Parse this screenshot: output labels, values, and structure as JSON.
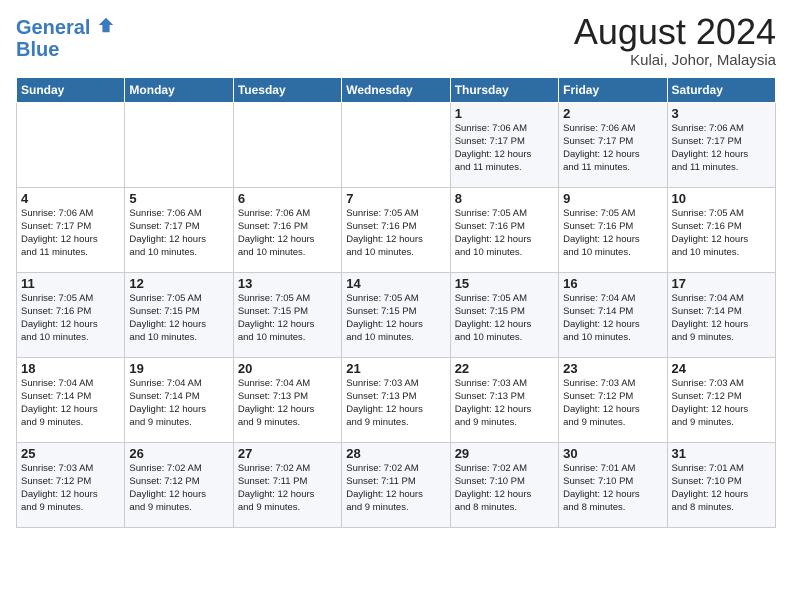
{
  "logo": {
    "line1": "General",
    "line2": "Blue"
  },
  "title": "August 2024",
  "subtitle": "Kulai, Johor, Malaysia",
  "weekdays": [
    "Sunday",
    "Monday",
    "Tuesday",
    "Wednesday",
    "Thursday",
    "Friday",
    "Saturday"
  ],
  "weeks": [
    [
      {
        "day": "",
        "info": ""
      },
      {
        "day": "",
        "info": ""
      },
      {
        "day": "",
        "info": ""
      },
      {
        "day": "",
        "info": ""
      },
      {
        "day": "1",
        "info": "Sunrise: 7:06 AM\nSunset: 7:17 PM\nDaylight: 12 hours\nand 11 minutes."
      },
      {
        "day": "2",
        "info": "Sunrise: 7:06 AM\nSunset: 7:17 PM\nDaylight: 12 hours\nand 11 minutes."
      },
      {
        "day": "3",
        "info": "Sunrise: 7:06 AM\nSunset: 7:17 PM\nDaylight: 12 hours\nand 11 minutes."
      }
    ],
    [
      {
        "day": "4",
        "info": "Sunrise: 7:06 AM\nSunset: 7:17 PM\nDaylight: 12 hours\nand 11 minutes."
      },
      {
        "day": "5",
        "info": "Sunrise: 7:06 AM\nSunset: 7:17 PM\nDaylight: 12 hours\nand 10 minutes."
      },
      {
        "day": "6",
        "info": "Sunrise: 7:06 AM\nSunset: 7:16 PM\nDaylight: 12 hours\nand 10 minutes."
      },
      {
        "day": "7",
        "info": "Sunrise: 7:05 AM\nSunset: 7:16 PM\nDaylight: 12 hours\nand 10 minutes."
      },
      {
        "day": "8",
        "info": "Sunrise: 7:05 AM\nSunset: 7:16 PM\nDaylight: 12 hours\nand 10 minutes."
      },
      {
        "day": "9",
        "info": "Sunrise: 7:05 AM\nSunset: 7:16 PM\nDaylight: 12 hours\nand 10 minutes."
      },
      {
        "day": "10",
        "info": "Sunrise: 7:05 AM\nSunset: 7:16 PM\nDaylight: 12 hours\nand 10 minutes."
      }
    ],
    [
      {
        "day": "11",
        "info": "Sunrise: 7:05 AM\nSunset: 7:16 PM\nDaylight: 12 hours\nand 10 minutes."
      },
      {
        "day": "12",
        "info": "Sunrise: 7:05 AM\nSunset: 7:15 PM\nDaylight: 12 hours\nand 10 minutes."
      },
      {
        "day": "13",
        "info": "Sunrise: 7:05 AM\nSunset: 7:15 PM\nDaylight: 12 hours\nand 10 minutes."
      },
      {
        "day": "14",
        "info": "Sunrise: 7:05 AM\nSunset: 7:15 PM\nDaylight: 12 hours\nand 10 minutes."
      },
      {
        "day": "15",
        "info": "Sunrise: 7:05 AM\nSunset: 7:15 PM\nDaylight: 12 hours\nand 10 minutes."
      },
      {
        "day": "16",
        "info": "Sunrise: 7:04 AM\nSunset: 7:14 PM\nDaylight: 12 hours\nand 10 minutes."
      },
      {
        "day": "17",
        "info": "Sunrise: 7:04 AM\nSunset: 7:14 PM\nDaylight: 12 hours\nand 9 minutes."
      }
    ],
    [
      {
        "day": "18",
        "info": "Sunrise: 7:04 AM\nSunset: 7:14 PM\nDaylight: 12 hours\nand 9 minutes."
      },
      {
        "day": "19",
        "info": "Sunrise: 7:04 AM\nSunset: 7:14 PM\nDaylight: 12 hours\nand 9 minutes."
      },
      {
        "day": "20",
        "info": "Sunrise: 7:04 AM\nSunset: 7:13 PM\nDaylight: 12 hours\nand 9 minutes."
      },
      {
        "day": "21",
        "info": "Sunrise: 7:03 AM\nSunset: 7:13 PM\nDaylight: 12 hours\nand 9 minutes."
      },
      {
        "day": "22",
        "info": "Sunrise: 7:03 AM\nSunset: 7:13 PM\nDaylight: 12 hours\nand 9 minutes."
      },
      {
        "day": "23",
        "info": "Sunrise: 7:03 AM\nSunset: 7:12 PM\nDaylight: 12 hours\nand 9 minutes."
      },
      {
        "day": "24",
        "info": "Sunrise: 7:03 AM\nSunset: 7:12 PM\nDaylight: 12 hours\nand 9 minutes."
      }
    ],
    [
      {
        "day": "25",
        "info": "Sunrise: 7:03 AM\nSunset: 7:12 PM\nDaylight: 12 hours\nand 9 minutes."
      },
      {
        "day": "26",
        "info": "Sunrise: 7:02 AM\nSunset: 7:12 PM\nDaylight: 12 hours\nand 9 minutes."
      },
      {
        "day": "27",
        "info": "Sunrise: 7:02 AM\nSunset: 7:11 PM\nDaylight: 12 hours\nand 9 minutes."
      },
      {
        "day": "28",
        "info": "Sunrise: 7:02 AM\nSunset: 7:11 PM\nDaylight: 12 hours\nand 9 minutes."
      },
      {
        "day": "29",
        "info": "Sunrise: 7:02 AM\nSunset: 7:10 PM\nDaylight: 12 hours\nand 8 minutes."
      },
      {
        "day": "30",
        "info": "Sunrise: 7:01 AM\nSunset: 7:10 PM\nDaylight: 12 hours\nand 8 minutes."
      },
      {
        "day": "31",
        "info": "Sunrise: 7:01 AM\nSunset: 7:10 PM\nDaylight: 12 hours\nand 8 minutes."
      }
    ]
  ]
}
